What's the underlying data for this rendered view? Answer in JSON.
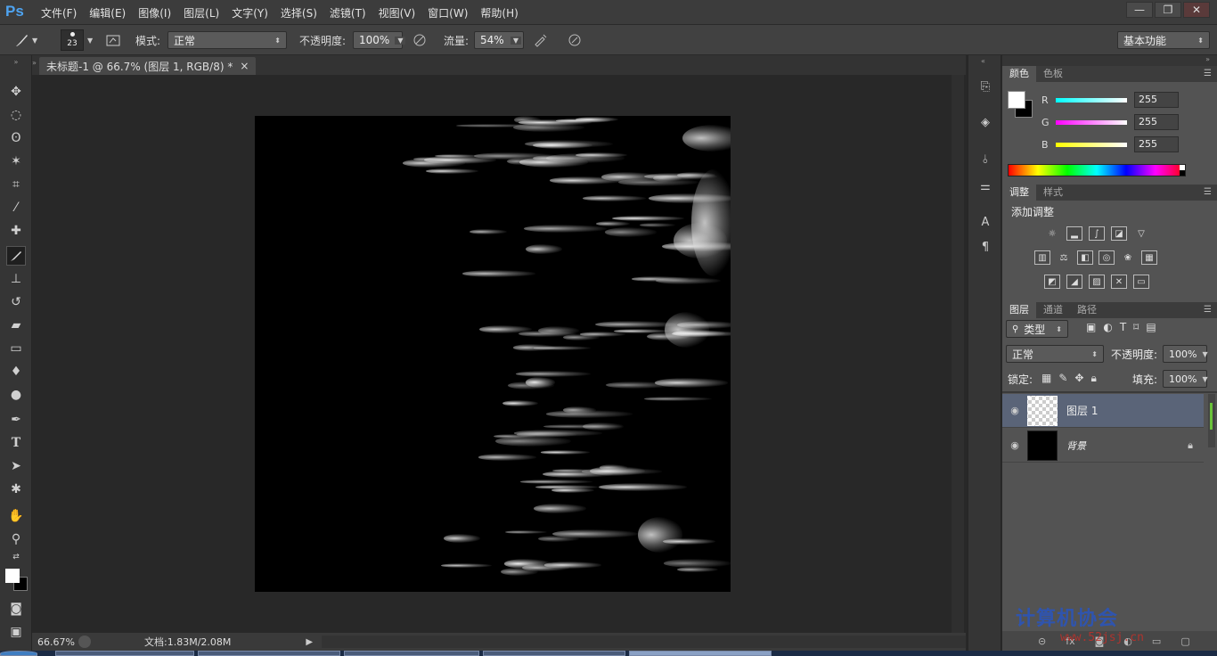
{
  "app": {
    "logo": "Ps",
    "menu": [
      "文件(F)",
      "编辑(E)",
      "图像(I)",
      "图层(L)",
      "文字(Y)",
      "选择(S)",
      "滤镜(T)",
      "视图(V)",
      "窗口(W)",
      "帮助(H)"
    ],
    "window_controls": [
      "—",
      "❐",
      "✕"
    ]
  },
  "options": {
    "brush_size": "23",
    "mode_label": "模式:",
    "mode_value": "正常",
    "opacity_label": "不透明度:",
    "opacity_value": "100%",
    "flow_label": "流量:",
    "flow_value": "54%",
    "workspace": "基本功能"
  },
  "document": {
    "tab_title": "未标题-1 @ 66.7% (图层 1, RGB/8) *",
    "close": "×"
  },
  "status": {
    "zoom": "66.67%",
    "doc_info": "文档:1.83M/2.08M"
  },
  "color_panel": {
    "tabs": [
      "颜色",
      "色板"
    ],
    "channels": [
      {
        "name": "R",
        "value": "255",
        "color": "#00ffff"
      },
      {
        "name": "G",
        "value": "255",
        "color": "#ff00ff"
      },
      {
        "name": "B",
        "value": "255",
        "color": "#ffff00"
      }
    ]
  },
  "adjust_panel": {
    "tabs": [
      "调整",
      "样式"
    ],
    "title": "添加调整"
  },
  "layers_panel": {
    "tabs": [
      "图层",
      "通道",
      "路径"
    ],
    "filter": "类型",
    "blend_mode": "正常",
    "opacity_label": "不透明度:",
    "opacity_value": "100%",
    "lock_label": "锁定:",
    "fill_label": "填充:",
    "fill_value": "100%",
    "layers": [
      {
        "name": "图层 1",
        "selected": true
      },
      {
        "name": "背景",
        "locked": true
      }
    ]
  },
  "watermark": {
    "text": "计算机协会",
    "url": "www.52jsj.cn"
  }
}
